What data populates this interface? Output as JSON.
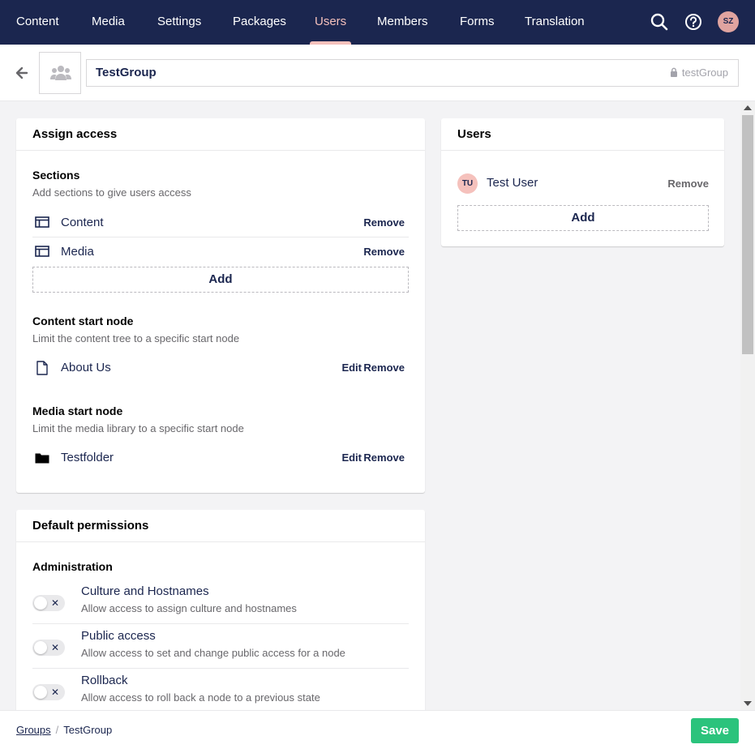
{
  "nav": {
    "items": [
      {
        "label": "Content"
      },
      {
        "label": "Media"
      },
      {
        "label": "Settings"
      },
      {
        "label": "Packages"
      },
      {
        "label": "Users",
        "active": true
      },
      {
        "label": "Members"
      },
      {
        "label": "Forms"
      },
      {
        "label": "Translation"
      }
    ],
    "user_initials": "SZ",
    "icons": [
      "search-icon",
      "help-icon"
    ]
  },
  "header": {
    "group_name": "TestGroup",
    "alias": "testGroup",
    "group_icon": "users-icon",
    "back_icon": "arrow-left-icon"
  },
  "assign_access": {
    "title": "Assign access",
    "sections": {
      "title": "Sections",
      "description": "Add sections to give users access",
      "items": [
        {
          "label": "Content",
          "icon": "section-icon",
          "remove": "Remove"
        },
        {
          "label": "Media",
          "icon": "section-icon",
          "remove": "Remove"
        }
      ],
      "add_label": "Add"
    },
    "content_start_node": {
      "title": "Content start node",
      "description": "Limit the content tree to a specific start node",
      "item": {
        "label": "About Us",
        "icon": "document-icon",
        "edit": "Edit",
        "remove": "Remove"
      }
    },
    "media_start_node": {
      "title": "Media start node",
      "description": "Limit the media library to a specific start node",
      "item": {
        "label": "Testfolder",
        "icon": "folder-icon",
        "edit": "Edit",
        "remove": "Remove"
      }
    }
  },
  "users": {
    "title": "Users",
    "items": [
      {
        "initials": "TU",
        "name": "Test User",
        "remove": "Remove"
      }
    ],
    "add_label": "Add"
  },
  "default_permissions": {
    "title": "Default permissions",
    "group": "Administration",
    "items": [
      {
        "title": "Culture and Hostnames",
        "description": "Allow access to assign culture and hostnames",
        "enabled": false
      },
      {
        "title": "Public access",
        "description": "Allow access to set and change public access for a node",
        "enabled": false
      },
      {
        "title": "Rollback",
        "description": "Allow access to roll back a node to a previous state",
        "enabled": false
      }
    ]
  },
  "footer": {
    "breadcrumb": [
      "Groups",
      "TestGroup"
    ],
    "separator": "/",
    "save_label": "Save"
  },
  "colors": {
    "nav_bg": "#1b264f",
    "active_accent": "#f5c1bc",
    "save": "#2bc37c"
  }
}
